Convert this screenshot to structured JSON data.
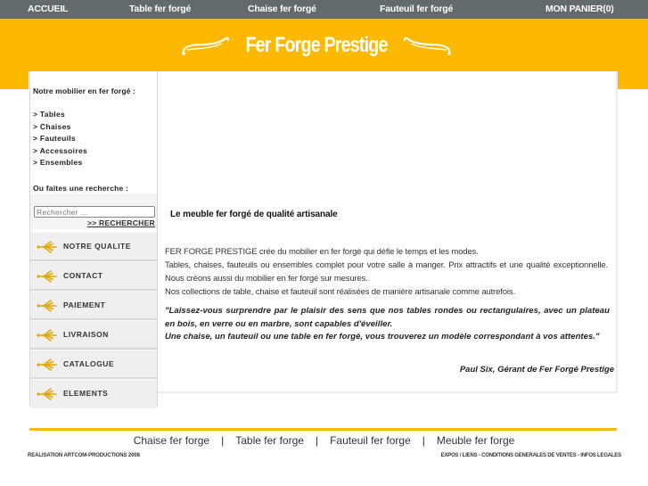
{
  "topnav": {
    "items": [
      {
        "label": "ACCUEIL"
      },
      {
        "label": "Table fer forgé"
      },
      {
        "label": "Chaise fer forgé"
      },
      {
        "label": "Fauteuil fer forgé"
      },
      {
        "label": "MON PANIER(0)"
      }
    ]
  },
  "banner": {
    "title": "Fer Forge Prestige",
    "background_color": "#fcb900"
  },
  "sidebar": {
    "heading": "Notre mobilier en fer forgé :",
    "categories": [
      {
        "label": "> Tables"
      },
      {
        "label": "> Chaises"
      },
      {
        "label": "> Fauteuils"
      },
      {
        "label": "> Accessoires"
      },
      {
        "label": "> Ensembles"
      }
    ],
    "search_label": "Ou faites une recherche :",
    "search_placeholder": "Rechercher ...",
    "search_button": ">> RECHERCHER",
    "menu": [
      {
        "label": "NOTRE QUALITE",
        "icon": "ornament-arrow-icon"
      },
      {
        "label": "CONTACT",
        "icon": "ornament-arrow-icon"
      },
      {
        "label": "PAIEMENT",
        "icon": "ornament-arrow-icon"
      },
      {
        "label": "LIVRAISON",
        "icon": "ornament-arrow-icon"
      },
      {
        "label": "CATALOGUE",
        "icon": "ornament-arrow-icon"
      },
      {
        "label": "ELEMENTS",
        "icon": "ornament-arrow-icon"
      }
    ]
  },
  "content": {
    "heading": "Le meuble fer forgé de qualité artisanale",
    "intro_lines": [
      "FER FORGE PRESTIGE crée du mobilier en fer forgé qui défie le temps et les modes.",
      "Tables, chaises, fauteuils ou ensembles complet pour votre salle à manger. Prix attractifs et une qualité exceptionnelle. Nous créons aussi du mobilier en fer forgé sur mesures.",
      "Nos collections de table, chaise et fauteuil sont réalisées de manière artisanale comme autrefois."
    ],
    "quote_lines": [
      "\"Laissez-vous surprendre par le plaisir des sens que nos tables rondes ou rectangulaires, avec un plateau en bois, en verre ou en marbre, sont capables d'éveiller.",
      "Une chaise, un fauteuil ou une table en fer forgé, vous trouverez un modèle correspondant à vos attentes.\""
    ],
    "signature": "Paul Six, Gérant de Fer Forgé Prestige"
  },
  "footer": {
    "links": [
      {
        "label": "Chaise fer forge"
      },
      {
        "label": "Table fer forge"
      },
      {
        "label": "Fauteuil fer forge"
      },
      {
        "label": "Meuble fer forge"
      }
    ],
    "separator": "|",
    "credit": "REALISATION ARTCOM-PRODUCTIONS 2008",
    "legal_links": [
      {
        "label": "EXPOS / LIENS"
      },
      {
        "label": "CONDITIONS GENERALES DE VENTES"
      },
      {
        "label": "INFOS LEGALES"
      }
    ],
    "legal_separator": " - "
  },
  "colors": {
    "accent": "#fcb900",
    "nav_bg": "#636a6b",
    "icon_gold": "#e0a600"
  }
}
